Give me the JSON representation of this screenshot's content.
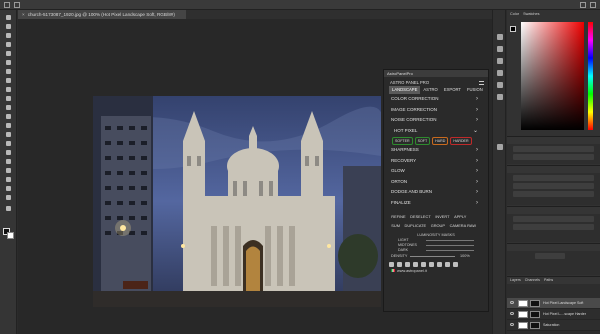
{
  "document": {
    "tab_title": "church-5173087_1920.jpg @ 100% (Hot Pixel Landscape Soft, RGB/8#)",
    "close_glyph": "×"
  },
  "astro_panel": {
    "window_title": "AstroPanelPro",
    "panel_title": "ASTRO PANEL PRO",
    "tabs": [
      "LANDSCAPE",
      "ASTRO",
      "EXPORT",
      "FUSION"
    ],
    "active_tab": "LANDSCAPE",
    "sections": [
      {
        "label": "COLOR CORRECTION",
        "arrow": "›"
      },
      {
        "label": "IMAGE CORRECTION",
        "arrow": "›"
      },
      {
        "label": "NOISE CORRECTION",
        "arrow": "›"
      }
    ],
    "hot_pixel": {
      "label": "HOT PIXEL",
      "arrow": "⌄"
    },
    "chips": [
      {
        "label": "SOFTER",
        "color": "#2e8b2e"
      },
      {
        "label": "SOFT",
        "color": "#2e8b2e"
      },
      {
        "label": "HARD",
        "color": "#c96a1e"
      },
      {
        "label": "HARDER",
        "color": "#c02a2a"
      }
    ],
    "sections2": [
      {
        "label": "SHARPNESS",
        "arrow": "›"
      },
      {
        "label": "RECOVERY",
        "arrow": "›"
      },
      {
        "label": "GLOW",
        "arrow": "›"
      },
      {
        "label": "ORTON",
        "arrow": "›"
      },
      {
        "label": "DODGE AND BURN",
        "arrow": "›"
      },
      {
        "label": "FINALIZE",
        "arrow": "›"
      }
    ],
    "buttons_row1": [
      "REFINE",
      "DESELECT",
      "INVERT",
      "APPLY"
    ],
    "buttons_row2": [
      "SUM",
      "DUPLICATE",
      "GROUP",
      "CAMERA RAW"
    ],
    "luminosity": {
      "title": "LUMINOSITY MASKS",
      "rows": [
        "LIGHT",
        "MIDTONES",
        "DARK"
      ]
    },
    "density": {
      "label": "DENSITY",
      "value": "100%"
    },
    "website": "www.astropanel.it"
  },
  "right_panel": {
    "color_tab": "Color",
    "swatches_tab": "Swatches",
    "layers_tab": "Layers",
    "channels_tab": "Channels",
    "paths_tab": "Paths",
    "layers": [
      {
        "name": "Hot Pixel Landscape Soft",
        "selected": true
      },
      {
        "name": "Hot Pixel L....scape Harder",
        "selected": false
      },
      {
        "name": "Saturation",
        "selected": false
      }
    ]
  },
  "colors": {
    "bg": "#2b2b2b",
    "panel": "#2a2a2a",
    "active_tab": "#5a5a5a",
    "sky_top": "#3b4a78"
  }
}
